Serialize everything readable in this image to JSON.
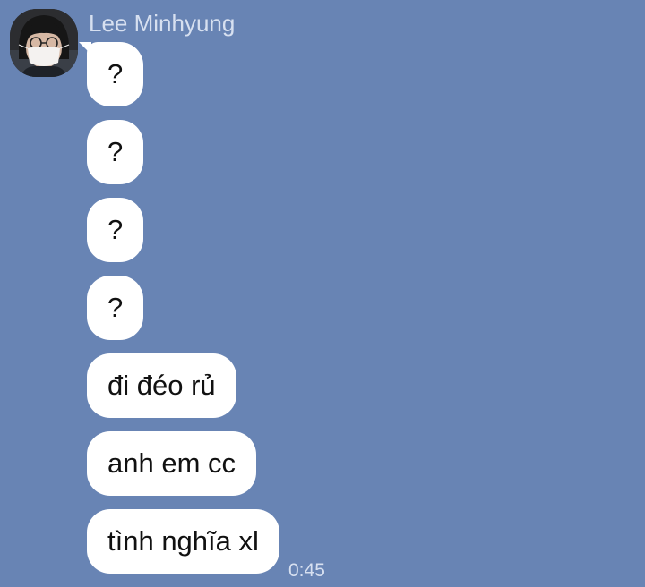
{
  "chat": {
    "sender": {
      "name": "Lee Minhyung",
      "avatar_icon": "profile-photo"
    },
    "messages": [
      {
        "text": "?"
      },
      {
        "text": "?"
      },
      {
        "text": "?"
      },
      {
        "text": "?"
      },
      {
        "text": "đi đéo rủ"
      },
      {
        "text": "anh em cc"
      },
      {
        "text": "tình nghĩa xl",
        "time": "0:45"
      }
    ]
  },
  "colors": {
    "background": "#6884b4",
    "bubble": "#ffffff",
    "meta_text": "#d7e0f0",
    "message_text": "#111111"
  }
}
